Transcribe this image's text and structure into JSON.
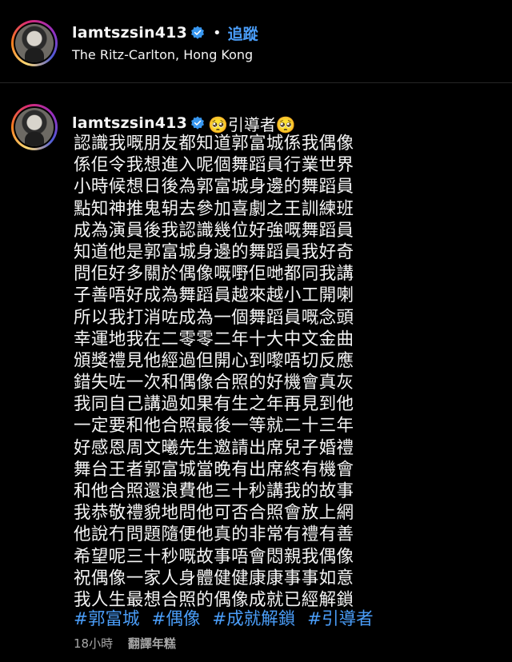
{
  "colors": {
    "background": "#000000",
    "text": "#f5f5f5",
    "link": "#4a9df8",
    "muted": "#a8a8a8",
    "verified": "#3897f0"
  },
  "header": {
    "username": "lamtszsin413",
    "dot": "•",
    "follow_label": "追蹤",
    "location": "The Ritz-Carlton, Hong Kong",
    "verified_icon": "verified-badge-icon"
  },
  "post": {
    "username": "lamtszsin413",
    "title_tag": "🥺引導者🥺",
    "caption_lines": [
      "認識我嘅朋友都知道郭富城係我偶像",
      "係佢令我想進入呢個舞蹈員行業世界",
      "小時候想日後為郭富城身邊的舞蹈員",
      "點知神推鬼䢁去參加喜劇之王訓練班",
      "成為演員後我認識幾位好強嘅舞蹈員",
      "知道他是郭富城身邊的舞蹈員我好奇",
      "問佢好多關於偶像嘅嘢佢哋都同我講",
      "子善唔好成為舞蹈員越來越小工開喇",
      "所以我打消咗成為一個舞蹈員嘅念頭",
      "幸運地我在二零零二年十大中文金曲",
      "頒獎禮見他經過但開心到嚟唔切反應",
      "錯失咗一次和偶像合照的好機會真灰",
      "我同自己講過如果有生之年再見到他",
      "一定要和他合照最後一等就二十三年",
      "好感恩周文曦先生邀請出席兒子婚禮",
      "舞台王者郭富城當晚有出席終有機會",
      "和他合照還浪費他三十秒講我的故事",
      "我恭敬禮貌地問他可否合照會放上網",
      "他說冇問題隨便他真的非常有禮有善",
      "希望呢三十秒嘅故事唔會悶親我偶像",
      "祝偶像一家人身體健健康康事事如意",
      "我人生最想合照的偶像成就已經解鎖"
    ],
    "hashtags": [
      "#郭富城",
      "#偶像",
      "#成就解鎖",
      "#引導者"
    ],
    "timestamp": "18小時",
    "translate_label": "翻譯年糕"
  }
}
